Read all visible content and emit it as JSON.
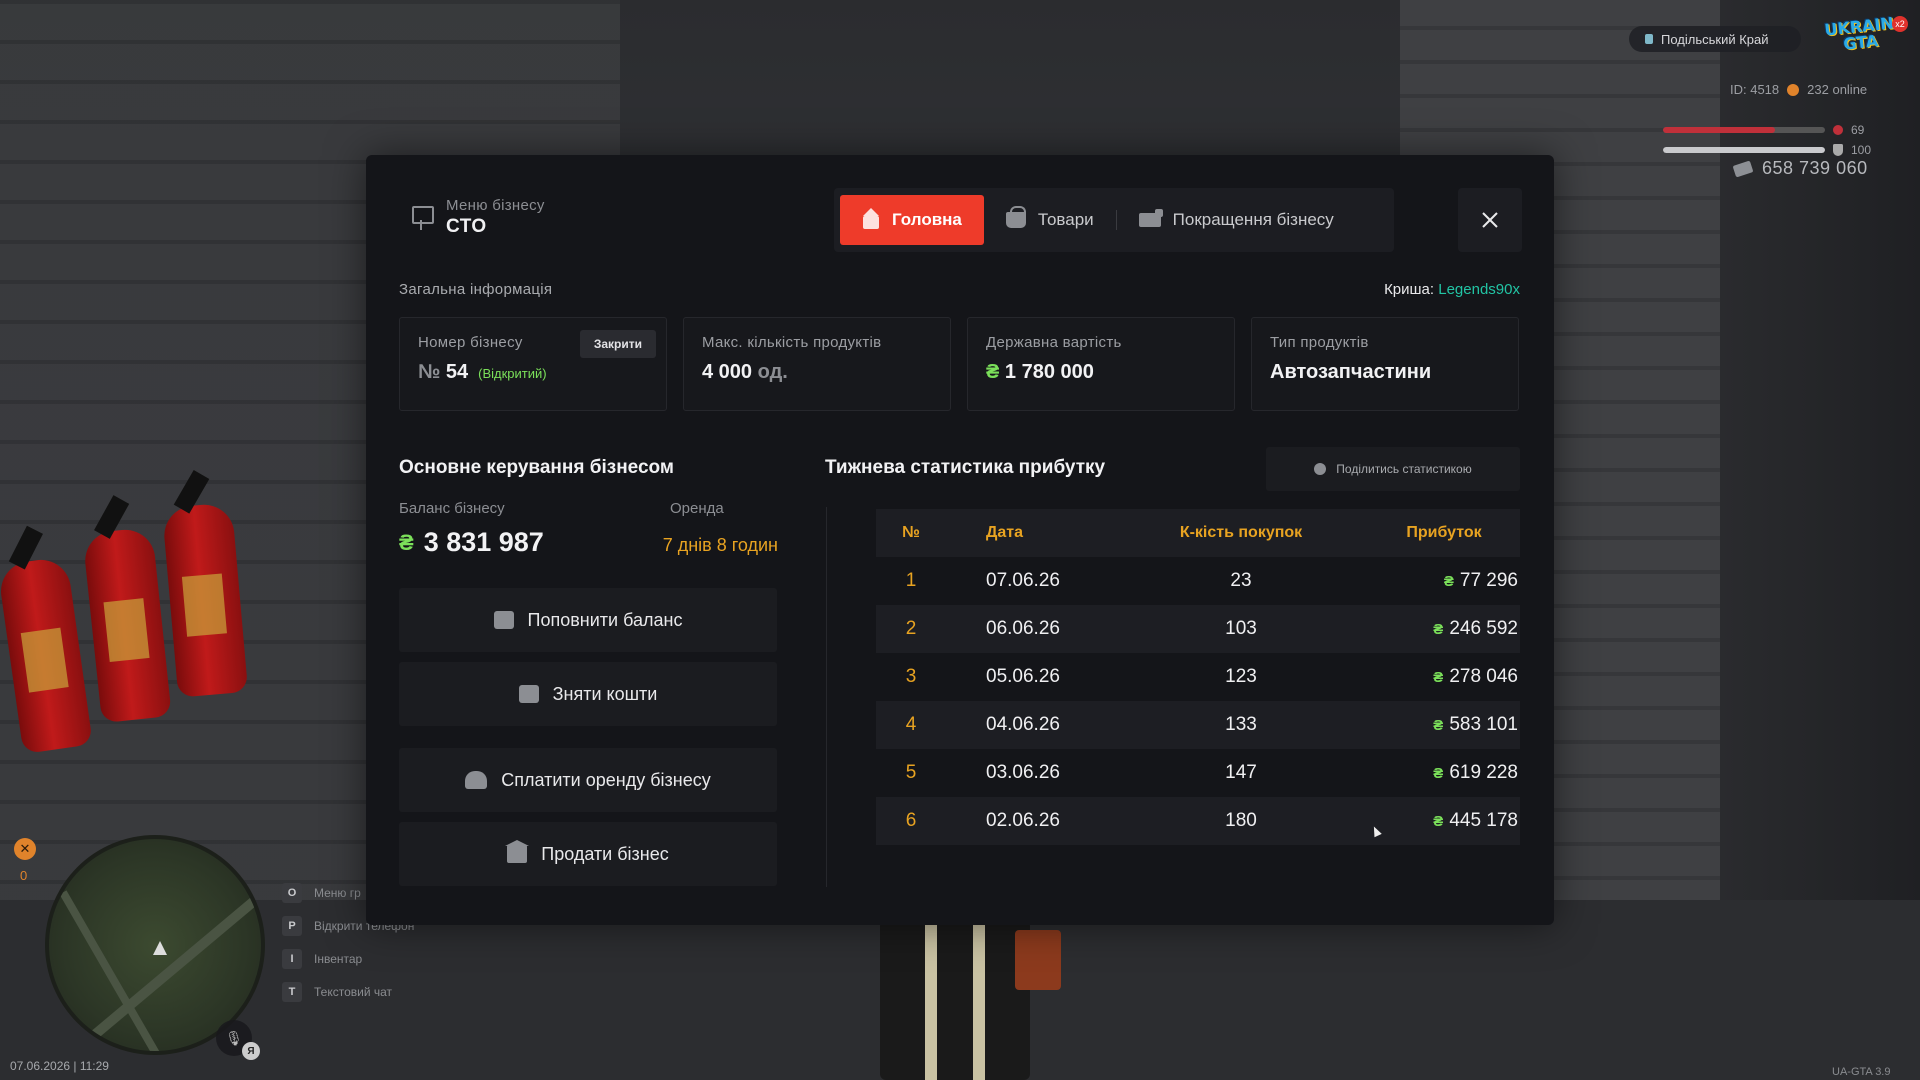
{
  "hud": {
    "server_name": "Подільський Край",
    "logo_text_1": "UKRAIN",
    "logo_text_2": "GTA",
    "logo_badge": "x2",
    "player_id": "ID: 4518",
    "online": "232 online",
    "health_value": "69",
    "health_fraction": 0.69,
    "armor_value": "100",
    "armor_fraction": 1.0,
    "money": "658 739 060",
    "x_counter": "0",
    "mic_badge": "Я",
    "datetime": "07.06.2026 | 11:29",
    "version": "UA-GTA 3.9",
    "hints": [
      {
        "key": "O",
        "label": "Меню гр"
      },
      {
        "key": "P",
        "label": "Відкрити телефон"
      },
      {
        "key": "I",
        "label": "Інвентар"
      },
      {
        "key": "T",
        "label": "Текстовий чат"
      }
    ]
  },
  "modal": {
    "header_small": "Меню бізнесу",
    "header_big": "СТО",
    "tabs": [
      {
        "label": "Головна",
        "icon": "house-icon",
        "active": true
      },
      {
        "label": "Товари",
        "icon": "basket-icon",
        "active": false
      },
      {
        "label": "Покращення бізнесу",
        "icon": "truck-icon",
        "active": false
      }
    ],
    "general_info_label": "Загальна інформація",
    "roof_label": "Криша:",
    "roof_name": "Legends90x",
    "cards": {
      "number": {
        "label": "Номер бізнесу",
        "prefix": "№",
        "value": "54",
        "status": "(Відкритий)",
        "button": "Закрити"
      },
      "max_products": {
        "label": "Макс. кількість продуктів",
        "value": "4 000",
        "unit": "од."
      },
      "state_value": {
        "label": "Державна вартість",
        "currency": "₴",
        "value": "1 780 000"
      },
      "product_type": {
        "label": "Тип продуктів",
        "value": "Автозапчастини"
      }
    },
    "control": {
      "title": "Основне керування бізнесом",
      "balance_label": "Баланс бізнесу",
      "balance_currency": "₴",
      "balance_value": "3 831 987",
      "rent_label": "Оренда",
      "rent_value": "7 днів 8 годин",
      "actions": [
        {
          "label": "Поповнити баланс",
          "icon": "deposit-icon"
        },
        {
          "label": "Зняти кошти",
          "icon": "withdraw-icon"
        },
        {
          "label": "Сплатити оренду бізнесу",
          "icon": "people-icon"
        },
        {
          "label": "Продати бізнес",
          "icon": "bank-icon"
        }
      ]
    },
    "stats": {
      "title": "Тижнева статистика прибутку",
      "share_label": "Поділитись статистикою",
      "columns": [
        "№",
        "Дата",
        "К-кість покупок",
        "Прибуток"
      ],
      "currency": "₴",
      "rows": [
        {
          "num": "1",
          "date": "07.06.26",
          "count": "23",
          "profit": "77 296"
        },
        {
          "num": "2",
          "date": "06.06.26",
          "count": "103",
          "profit": "246 592"
        },
        {
          "num": "3",
          "date": "05.06.26",
          "count": "123",
          "profit": "278 046"
        },
        {
          "num": "4",
          "date": "04.06.26",
          "count": "133",
          "profit": "583 101"
        },
        {
          "num": "5",
          "date": "03.06.26",
          "count": "147",
          "profit": "619 228"
        },
        {
          "num": "6",
          "date": "02.06.26",
          "count": "180",
          "profit": "445 178"
        }
      ]
    }
  },
  "colors": {
    "accent": "#ee3b2a",
    "orange": "#e8a321",
    "green": "#7be05a",
    "teal": "#22c4a4"
  }
}
